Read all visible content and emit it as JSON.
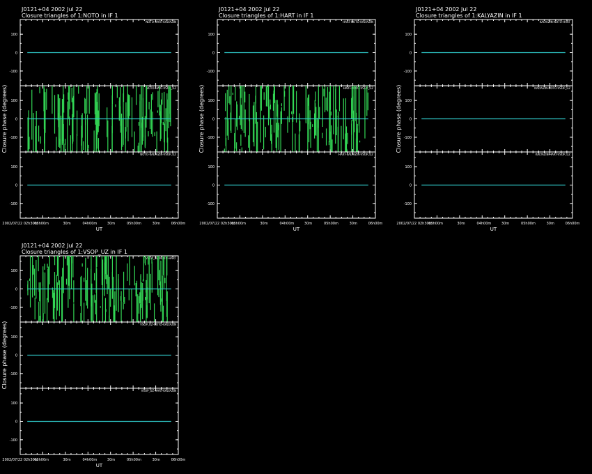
{
  "chart_data": [
    {
      "type": "scatter",
      "title": "J0121+04   2002 Jul 22",
      "subtitle": "Closure triangles of 1:NOTO in IF 1",
      "ylabel": "Closure phase  (degrees)",
      "xlabel": "UT",
      "x_ticks": [
        "2002/07/22 02h30m",
        "03h00m",
        "30m",
        "04h00m",
        "30m",
        "05h00m",
        "30m",
        "06h00m"
      ],
      "y_ticks": [
        "100",
        "0",
        "-100"
      ],
      "ylim": [
        -180,
        180
      ],
      "panels": [
        {
          "label": "NOTO-HART-KALYAZIN",
          "scatter": false
        },
        {
          "label": "NOTO-HART-VSOP_UZ",
          "scatter": true
        },
        {
          "label": "NOTO-KALYAZIN-VSOP_UZ",
          "scatter": false
        }
      ]
    },
    {
      "type": "scatter",
      "title": "J0121+04   2002 Jul 22",
      "subtitle": "Closure triangles of 1:HART in IF 1",
      "ylabel": "Closure phase  (degrees)",
      "xlabel": "UT",
      "x_ticks": [
        "2002/07/22 02h30m",
        "03h00m",
        "30m",
        "04h00m",
        "30m",
        "05h00m",
        "30m",
        "06h00m"
      ],
      "y_ticks": [
        "100",
        "0",
        "-100"
      ],
      "ylim": [
        -180,
        180
      ],
      "panels": [
        {
          "label": "HART-NOTO-KALYAZIN",
          "scatter": false
        },
        {
          "label": "HART-NOTO-VSOP_UZ",
          "scatter": true
        },
        {
          "label": "HART-KALYAZIN-VSOP_UZ",
          "scatter": false
        }
      ]
    },
    {
      "type": "scatter",
      "title": "J0121+04   2002 Jul 22",
      "subtitle": "Closure triangles of 1:KALYAZIN in IF 1",
      "ylabel": "Closure phase  (degrees)",
      "xlabel": "UT",
      "x_ticks": [
        "2002/07/22 02h30m",
        "03h00m",
        "30m",
        "04h00m",
        "30m",
        "05h00m",
        "30m",
        "06h00m"
      ],
      "y_ticks": [
        "100",
        "0",
        "-100"
      ],
      "ylim": [
        -180,
        180
      ],
      "panels": [
        {
          "label": "KALYAZIN-NOTO-HART",
          "scatter": false
        },
        {
          "label": "KALYAZIN-NOTO-VSOP_UZ",
          "scatter": false
        },
        {
          "label": "KALYAZIN-HART-VSOP_UZ",
          "scatter": false
        }
      ]
    },
    {
      "type": "scatter",
      "title": "J0121+04   2002 Jul 22",
      "subtitle": "Closure triangles of 1:VSOP_UZ in IF 1",
      "ylabel": "Closure phase  (degrees)",
      "xlabel": "UT",
      "x_ticks": [
        "2002/07/22 02h30m",
        "03h00m",
        "30m",
        "04h00m",
        "30m",
        "05h00m",
        "30m",
        "06h00m"
      ],
      "y_ticks": [
        "100",
        "0",
        "-100"
      ],
      "ylim": [
        -180,
        180
      ],
      "panels": [
        {
          "label": "VSOP_UZ-NOTO-HART",
          "scatter": true
        },
        {
          "label": "VSOP_UZ-NOTO-KALYAZIN",
          "scatter": false
        },
        {
          "label": "VSOP_UZ-HART-KALYAZIN",
          "scatter": false
        }
      ]
    }
  ],
  "colors": {
    "background": "#000000",
    "frame": "#ffffff",
    "zero_line": "#2fc8c8",
    "data": "#33d655"
  }
}
